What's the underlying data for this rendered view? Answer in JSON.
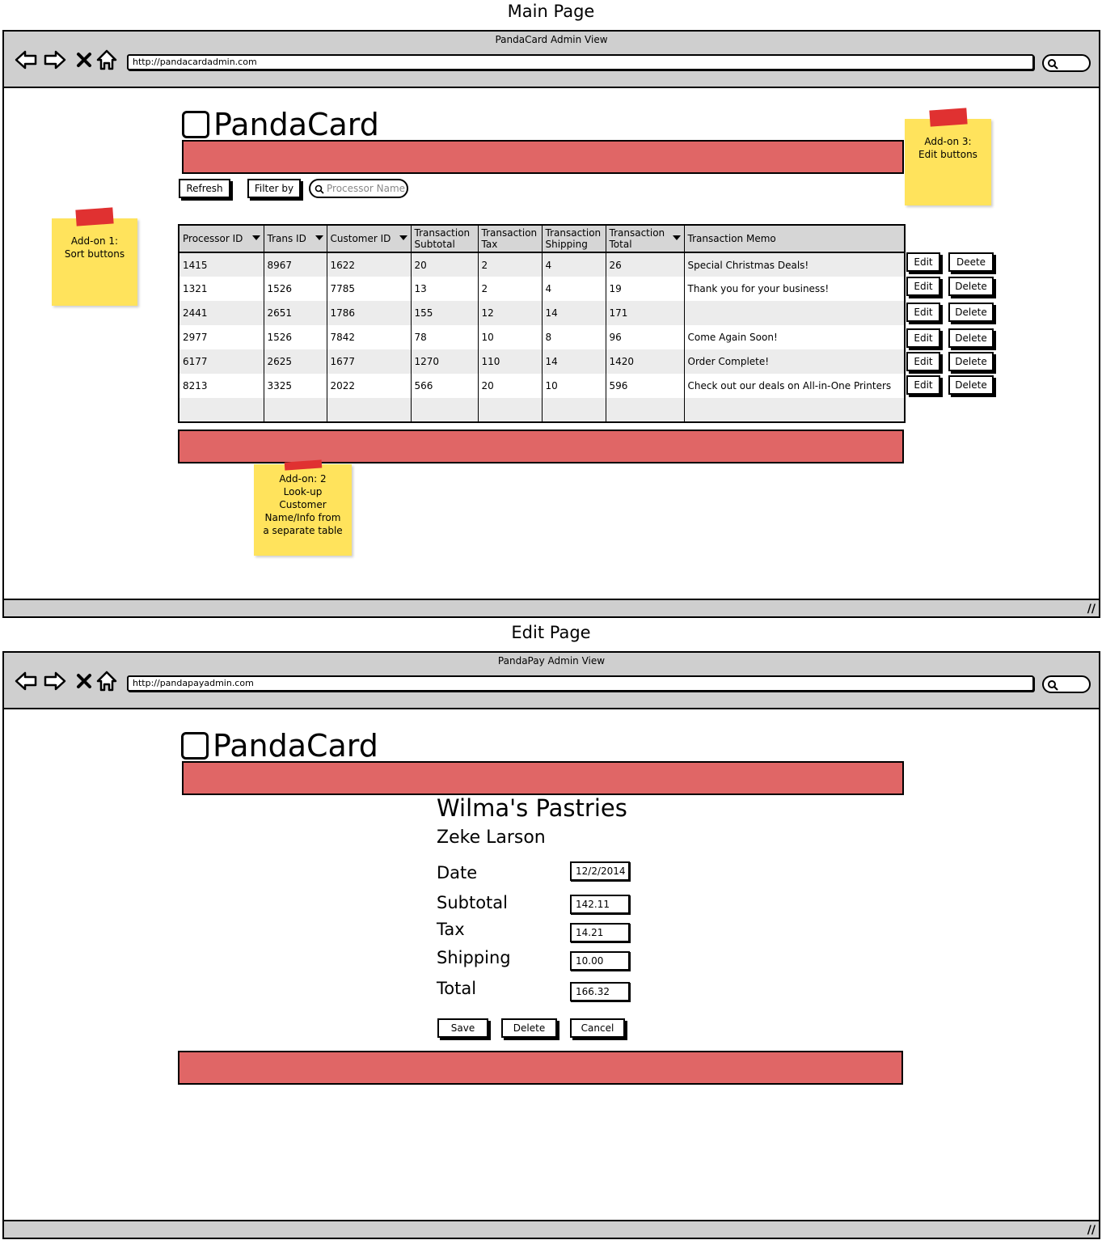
{
  "main_page": {
    "section_title": "Main Page",
    "window_title": "PandaCard Admin View",
    "url": "http://pandacardadmin.com",
    "logo": "PandaCard",
    "toolbar": {
      "refresh_label": "Refresh",
      "filter_label": "Filter by",
      "search_placeholder": "Processor Name"
    },
    "table": {
      "headers": [
        "Processor ID",
        "Trans ID",
        "Customer ID",
        "Transaction Subtotal",
        "Transaction Tax",
        "Transaction Shipping",
        "Transaction Total",
        "Transaction Memo"
      ],
      "rows": [
        [
          "1415",
          "8967",
          "1622",
          "20",
          "2",
          "4",
          "26",
          "Special  Christmas Deals!"
        ],
        [
          "1321",
          "1526",
          "7785",
          "13",
          "2",
          "4",
          "19",
          "Thank you for your business!"
        ],
        [
          "2441",
          "2651",
          "1786",
          "155",
          "12",
          "14",
          "171",
          ""
        ],
        [
          "2977",
          "1526",
          "7842",
          "78",
          "10",
          "8",
          "96",
          "Come Again Soon!"
        ],
        [
          "6177",
          "2625",
          "1677",
          "1270",
          "110",
          "14",
          "1420",
          "Order Complete!"
        ],
        [
          "8213",
          "3325",
          "2022",
          "566",
          "20",
          "10",
          "596",
          "Check out our deals on All-in-One Printers"
        ]
      ]
    },
    "row_actions": [
      {
        "edit": "Edit",
        "delete": "Deete"
      },
      {
        "edit": "Edit",
        "delete": "Delete"
      },
      {
        "edit": "Edit",
        "delete": "Delete"
      },
      {
        "edit": "Edit",
        "delete": "Delete"
      },
      {
        "edit": "Edit",
        "delete": "Delete"
      },
      {
        "edit": "Edit",
        "delete": "Delete"
      }
    ],
    "notes": {
      "addon1": [
        "Add-on 1:",
        "Sort buttons"
      ],
      "addon2": [
        "Add-on: 2",
        "Look-up",
        "Customer",
        "Name/Info from",
        "a separate table"
      ],
      "addon3": [
        "Add-on 3:",
        "Edit buttons"
      ]
    }
  },
  "edit_page": {
    "section_title": "Edit Page",
    "window_title": "PandaPay Admin View",
    "url": "http://pandapayadmin.com",
    "logo": "PandaCard",
    "business_name": "Wilma's Pastries",
    "customer_name": "Zeke Larson",
    "fields": {
      "date_label": "Date",
      "date_value": "12/2/2014",
      "subtotal_label": "Subtotal",
      "subtotal_value": "142.11",
      "tax_label": "Tax",
      "tax_value": "14.21",
      "shipping_label": "Shipping",
      "shipping_value": "10.00",
      "total_label": "Total",
      "total_value": "166.32"
    },
    "buttons": {
      "save": "Save",
      "delete": "Delete",
      "cancel": "Cancel"
    }
  },
  "colors": {
    "accent_bar": "#e06666",
    "sticky_note": "#ffe35c",
    "tape": "#e03131",
    "chrome": "#cfcfcf"
  }
}
